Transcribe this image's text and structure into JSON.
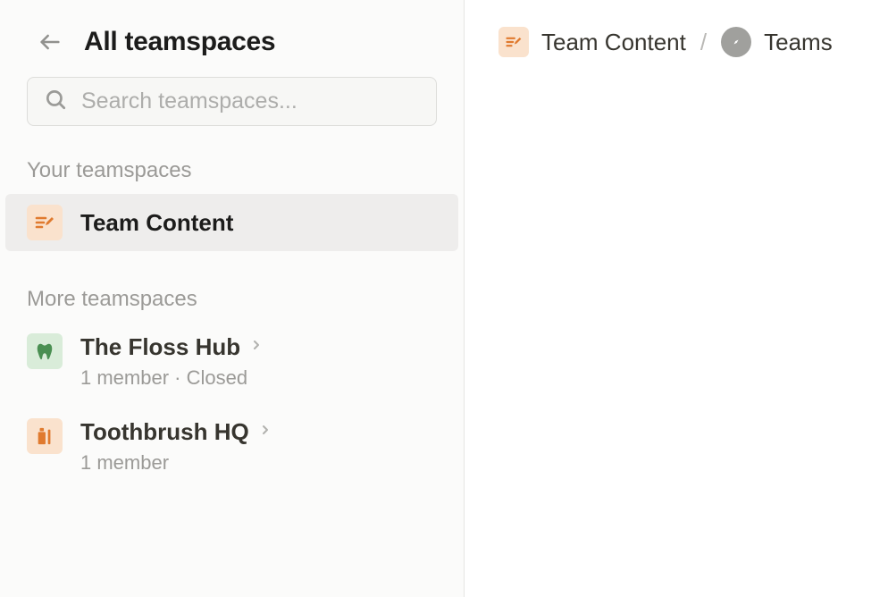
{
  "sidebar": {
    "title": "All teamspaces",
    "search_placeholder": "Search teamspaces...",
    "your_label": "Your teamspaces",
    "your_items": [
      {
        "name": "Team Content",
        "icon": "pencil",
        "icon_bg": "orange",
        "selected": true
      }
    ],
    "more_label": "More teamspaces",
    "more_items": [
      {
        "name": "The Floss Hub",
        "meta": "1 member · Closed",
        "icon": "tooth",
        "icon_bg": "green"
      },
      {
        "name": "Toothbrush HQ",
        "meta": "1 member",
        "icon": "bottle",
        "icon_bg": "orange"
      }
    ]
  },
  "breadcrumb": {
    "item1": "Team Content",
    "item2": "Teams"
  }
}
